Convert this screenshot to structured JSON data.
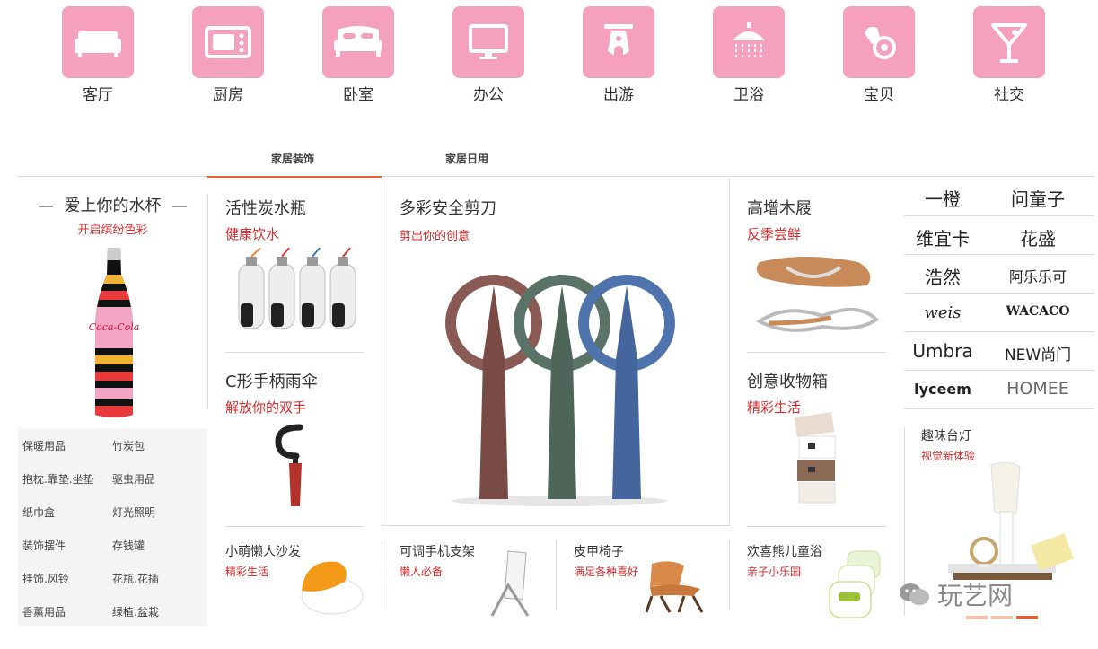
{
  "categories": [
    {
      "label": "客厅",
      "icon": "sofa-icon"
    },
    {
      "label": "厨房",
      "icon": "microwave-icon"
    },
    {
      "label": "卧室",
      "icon": "bed-icon"
    },
    {
      "label": "办公",
      "icon": "monitor-icon"
    },
    {
      "label": "出游",
      "icon": "scooter-icon"
    },
    {
      "label": "卫浴",
      "icon": "shower-icon"
    },
    {
      "label": "宝贝",
      "icon": "pacifier-icon"
    },
    {
      "label": "社交",
      "icon": "cocktail-icon"
    }
  ],
  "tabs": [
    {
      "label": "家居装饰",
      "active": true
    },
    {
      "label": "家居日用",
      "active": false
    }
  ],
  "promo": {
    "title": "爱上你的水杯",
    "subtitle": "开启缤纷色彩"
  },
  "links": [
    "保暖用品",
    "竹炭包",
    "抱枕.靠垫.坐垫",
    "驱虫用品",
    "纸巾盒",
    "灯光照明",
    "装饰摆件",
    "存钱罐",
    "挂饰.风铃",
    "花瓶.花插",
    "香薰用品",
    "绿植.盆栽"
  ],
  "products": {
    "charcoal_bottle": {
      "title": "活性炭水瓶",
      "subtitle": "健康饮水"
    },
    "umbrella": {
      "title": "C形手柄雨伞",
      "subtitle": "解放你的双手"
    },
    "scissors": {
      "title": "多彩安全剪刀",
      "subtitle": "剪出你的创意"
    },
    "clogs": {
      "title": "高增木屐",
      "subtitle": "反季尝鲜"
    },
    "storage_box": {
      "title": "创意收物箱",
      "subtitle": "精彩生活"
    },
    "lazy_sofa": {
      "title": "小萌懒人沙发",
      "subtitle": "精彩生活"
    },
    "phone_stand": {
      "title": "可调手机支架",
      "subtitle": "懒人必备"
    },
    "leather_chair": {
      "title": "皮甲椅子",
      "subtitle": "满足各种喜好"
    },
    "bath_tub": {
      "title": "欢喜熊儿童浴",
      "subtitle": "亲子小乐园"
    },
    "lamp": {
      "title": "趣味台灯",
      "subtitle": "视觉新体验"
    }
  },
  "brands": [
    "一橙",
    "问童子",
    "维宜卡",
    "花盛",
    "浩然",
    "阿乐乐可",
    "weis",
    "WACACO",
    "Umbra",
    "NEW尚门",
    "lyceem",
    "HOMEE"
  ],
  "watermark": "玩艺网",
  "colors": {
    "accent": "#e8622e",
    "tile": "#f5a1bd",
    "red_text": "#d82a2a"
  }
}
